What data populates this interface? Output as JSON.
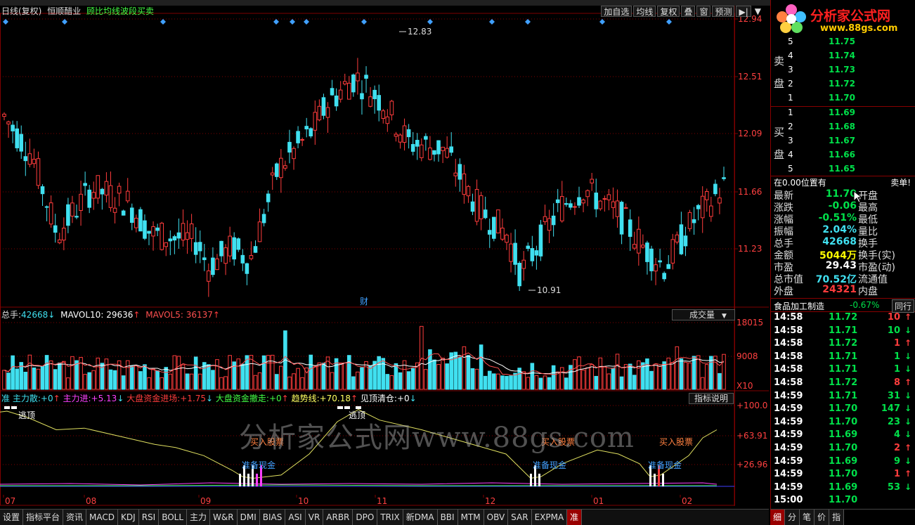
{
  "colors": {
    "up": "#ff3c3c",
    "down": "#40e0f0",
    "grid": "#800000",
    "ma_yellow": "#e0e060",
    "white": "#ffffff"
  },
  "header": {
    "period": "日线(复权)",
    "stock": "恒顺醋业",
    "indicator": "顾比均线波段买卖"
  },
  "toolbar": {
    "btn1": "加自选",
    "btn2": "均线",
    "btn3": "复权",
    "btn4": "叠",
    "btn5": "窗",
    "btn6": "预测",
    "btn7": "▶|",
    "btn8": "▼"
  },
  "main": {
    "high_label": "12.83",
    "low_label": "10.91",
    "cai_label": "财",
    "yaxis": [
      "12.94",
      "12.51",
      "12.09",
      "11.66",
      "11.23"
    ]
  },
  "vol": {
    "title": "总手:",
    "total": "42668",
    "ma10_label": "MAVOL10:",
    "ma10": "29636",
    "ma5_label": "MAVOL5:",
    "ma5": "36137",
    "select": "成交量",
    "yaxis": [
      "18015",
      "9008",
      "X10"
    ]
  },
  "ind": {
    "l1": "主力散:",
    "v1": "+0",
    "l2": "主力进:",
    "v2": "+5.13",
    "l3": "大盘资金进场:",
    "v3": "+1.75",
    "l4": "大盘资金撤走:",
    "v4": "+0",
    "l5": "趋势线:",
    "v5": "+70.18",
    "l6": "见顶清仓:",
    "v6": "+0",
    "explain": "指标说明",
    "yaxis": [
      "+100.0",
      "+63.91",
      "+26.96"
    ],
    "signal_top": "逃顶",
    "signal_buy": "买入股票",
    "signal_cash": "准备现金",
    "marker": "准"
  },
  "xaxis": [
    "07",
    "08",
    "09",
    "10",
    "11",
    "12",
    "01",
    "02"
  ],
  "watermark": "分析家公式网www.88gs.com",
  "logo": {
    "text": "分析家公式网",
    "url": "www.88gs.com"
  },
  "orderbook": {
    "sell_label": [
      "卖",
      "盘"
    ],
    "buy_label": [
      "买",
      "盘"
    ],
    "asks": [
      {
        "l": "5",
        "p": "11.75"
      },
      {
        "l": "4",
        "p": "11.74"
      },
      {
        "l": "3",
        "p": "11.73"
      },
      {
        "l": "2",
        "p": "11.72"
      },
      {
        "l": "1",
        "p": "11.70"
      }
    ],
    "bids": [
      {
        "l": "1",
        "p": "11.69"
      },
      {
        "l": "2",
        "p": "11.68"
      },
      {
        "l": "3",
        "p": "11.67"
      },
      {
        "l": "4",
        "p": "11.66"
      },
      {
        "l": "5",
        "p": "11.65"
      }
    ],
    "pos_label": "在0.00位置有",
    "pos_right": "卖单!"
  },
  "quote": [
    {
      "l": "最新",
      "v": "11.70",
      "n": "开盘",
      "c": "#00e04a"
    },
    {
      "l": "涨跌",
      "v": "-0.06",
      "n": "最高",
      "c": "#00e04a"
    },
    {
      "l": "涨幅",
      "v": "-0.51%",
      "n": "最低",
      "c": "#00e04a"
    },
    {
      "l": "振幅",
      "v": "2.04%",
      "n": "量比",
      "c": "#40e0f0"
    },
    {
      "l": "总手",
      "v": "42668",
      "n": "换手",
      "c": "#40e0f0"
    },
    {
      "l": "金额",
      "v": "5044万",
      "n": "换手(实)",
      "c": "#ffff00"
    },
    {
      "l": "市盈",
      "v": "29.43",
      "n": "市盈(动)",
      "c": "#ffffff"
    },
    {
      "l": "总市值",
      "v": "70.52亿",
      "n": "流通值",
      "c": "#40e0f0"
    },
    {
      "l": "外盘",
      "v": "24321",
      "n": "内盘",
      "c": "#ff3c3c"
    }
  ],
  "sector": {
    "name": "食品加工制造",
    "chg": "-0.67%",
    "tab": "同行"
  },
  "ticks": [
    {
      "t": "14:58",
      "p": "11.72",
      "v": "10",
      "d": "up"
    },
    {
      "t": "14:58",
      "p": "11.71",
      "v": "10",
      "d": "down"
    },
    {
      "t": "14:58",
      "p": "11.72",
      "v": "1",
      "d": "up"
    },
    {
      "t": "14:58",
      "p": "11.71",
      "v": "1",
      "d": "down"
    },
    {
      "t": "14:58",
      "p": "11.71",
      "v": "1",
      "d": "down"
    },
    {
      "t": "14:58",
      "p": "11.72",
      "v": "8",
      "d": "up"
    },
    {
      "t": "14:59",
      "p": "11.71",
      "v": "31",
      "d": "down"
    },
    {
      "t": "14:59",
      "p": "11.70",
      "v": "147",
      "d": "down"
    },
    {
      "t": "14:59",
      "p": "11.70",
      "v": "23",
      "d": "down"
    },
    {
      "t": "14:59",
      "p": "11.69",
      "v": "4",
      "d": "down"
    },
    {
      "t": "14:59",
      "p": "11.70",
      "v": "2",
      "d": "up"
    },
    {
      "t": "14:59",
      "p": "11.69",
      "v": "9",
      "d": "down"
    },
    {
      "t": "14:59",
      "p": "11.70",
      "v": "1",
      "d": "up"
    },
    {
      "t": "14:59",
      "p": "11.69",
      "v": "53",
      "d": "down"
    },
    {
      "t": "15:00",
      "p": "11.70",
      "v": "",
      "d": "none"
    }
  ],
  "bottom_tabs": [
    "设置",
    "指标平台",
    "资讯",
    "MACD",
    "KDJ",
    "RSI",
    "BOLL",
    "主力",
    "W&R",
    "DMI",
    "BIAS",
    "ASI",
    "VR",
    "ARBR",
    "DPO",
    "TRIX",
    "新DMA",
    "BBI",
    "MTM",
    "OBV",
    "SAR",
    "EXPMA",
    "准"
  ],
  "right_tabs": [
    "细",
    "分",
    "笔",
    "价",
    "指"
  ]
}
